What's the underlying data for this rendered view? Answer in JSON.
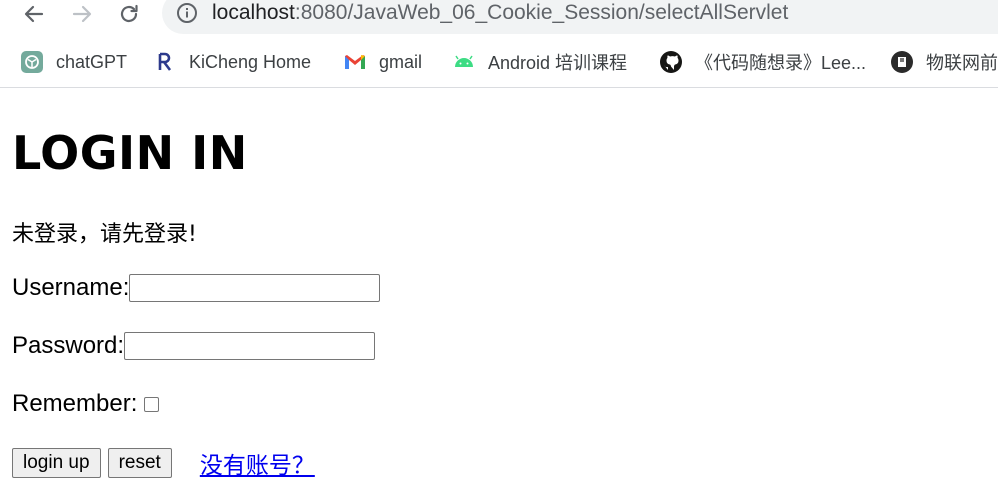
{
  "browser": {
    "url_host": "localhost",
    "url_path": ":8080/JavaWeb_06_Cookie_Session/selectAllServlet",
    "nav": {
      "back_icon": "arrow-left",
      "forward_icon": "arrow-right",
      "reload_icon": "reload",
      "info_icon": "info-circle"
    }
  },
  "bookmarks": [
    {
      "label": "chatGPT",
      "icon": "chatgpt-logo"
    },
    {
      "label": "KiCheng Home",
      "icon": "kicheng-logo"
    },
    {
      "label": "gmail",
      "icon": "gmail-logo"
    },
    {
      "label": "Android 培训课程",
      "icon": "android-logo"
    },
    {
      "label": "《代码随想录》Lee...",
      "icon": "github-logo"
    },
    {
      "label": "物联网前",
      "icon": "notion-style-logo"
    }
  ],
  "page": {
    "heading": "LOGIN IN",
    "message": "未登录，请先登录!",
    "username_label": "Username:",
    "username_value": "",
    "password_label": "Password:",
    "password_value": "",
    "remember_label": "Remember:",
    "remember_checked": false,
    "login_button": "login up",
    "reset_button": "reset",
    "register_link": "没有账号？"
  },
  "colors": {
    "link": "#0000ee",
    "omnibox_bg": "#f1f3f4"
  }
}
